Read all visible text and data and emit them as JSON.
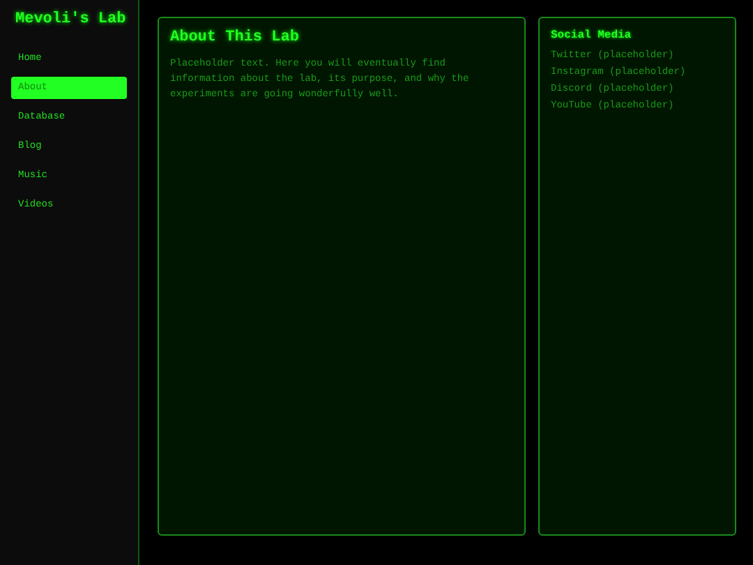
{
  "sidebar": {
    "title": "Mevoli's Lab",
    "items": [
      {
        "label": "Home",
        "selected": false
      },
      {
        "label": "About",
        "selected": true
      },
      {
        "label": "Database",
        "selected": false
      },
      {
        "label": "Blog",
        "selected": false
      },
      {
        "label": "Music",
        "selected": false
      },
      {
        "label": "Videos",
        "selected": false
      }
    ]
  },
  "main": {
    "title": "About This Lab",
    "text": "Placeholder text. Here you will eventually find information about the lab, its purpose, and why the experiments are going wonderfully well."
  },
  "aside": {
    "title": "Social Media",
    "links": [
      "Twitter (placeholder)",
      "Instagram (placeholder)",
      "Discord (placeholder)",
      "YouTube (placeholder)"
    ]
  }
}
